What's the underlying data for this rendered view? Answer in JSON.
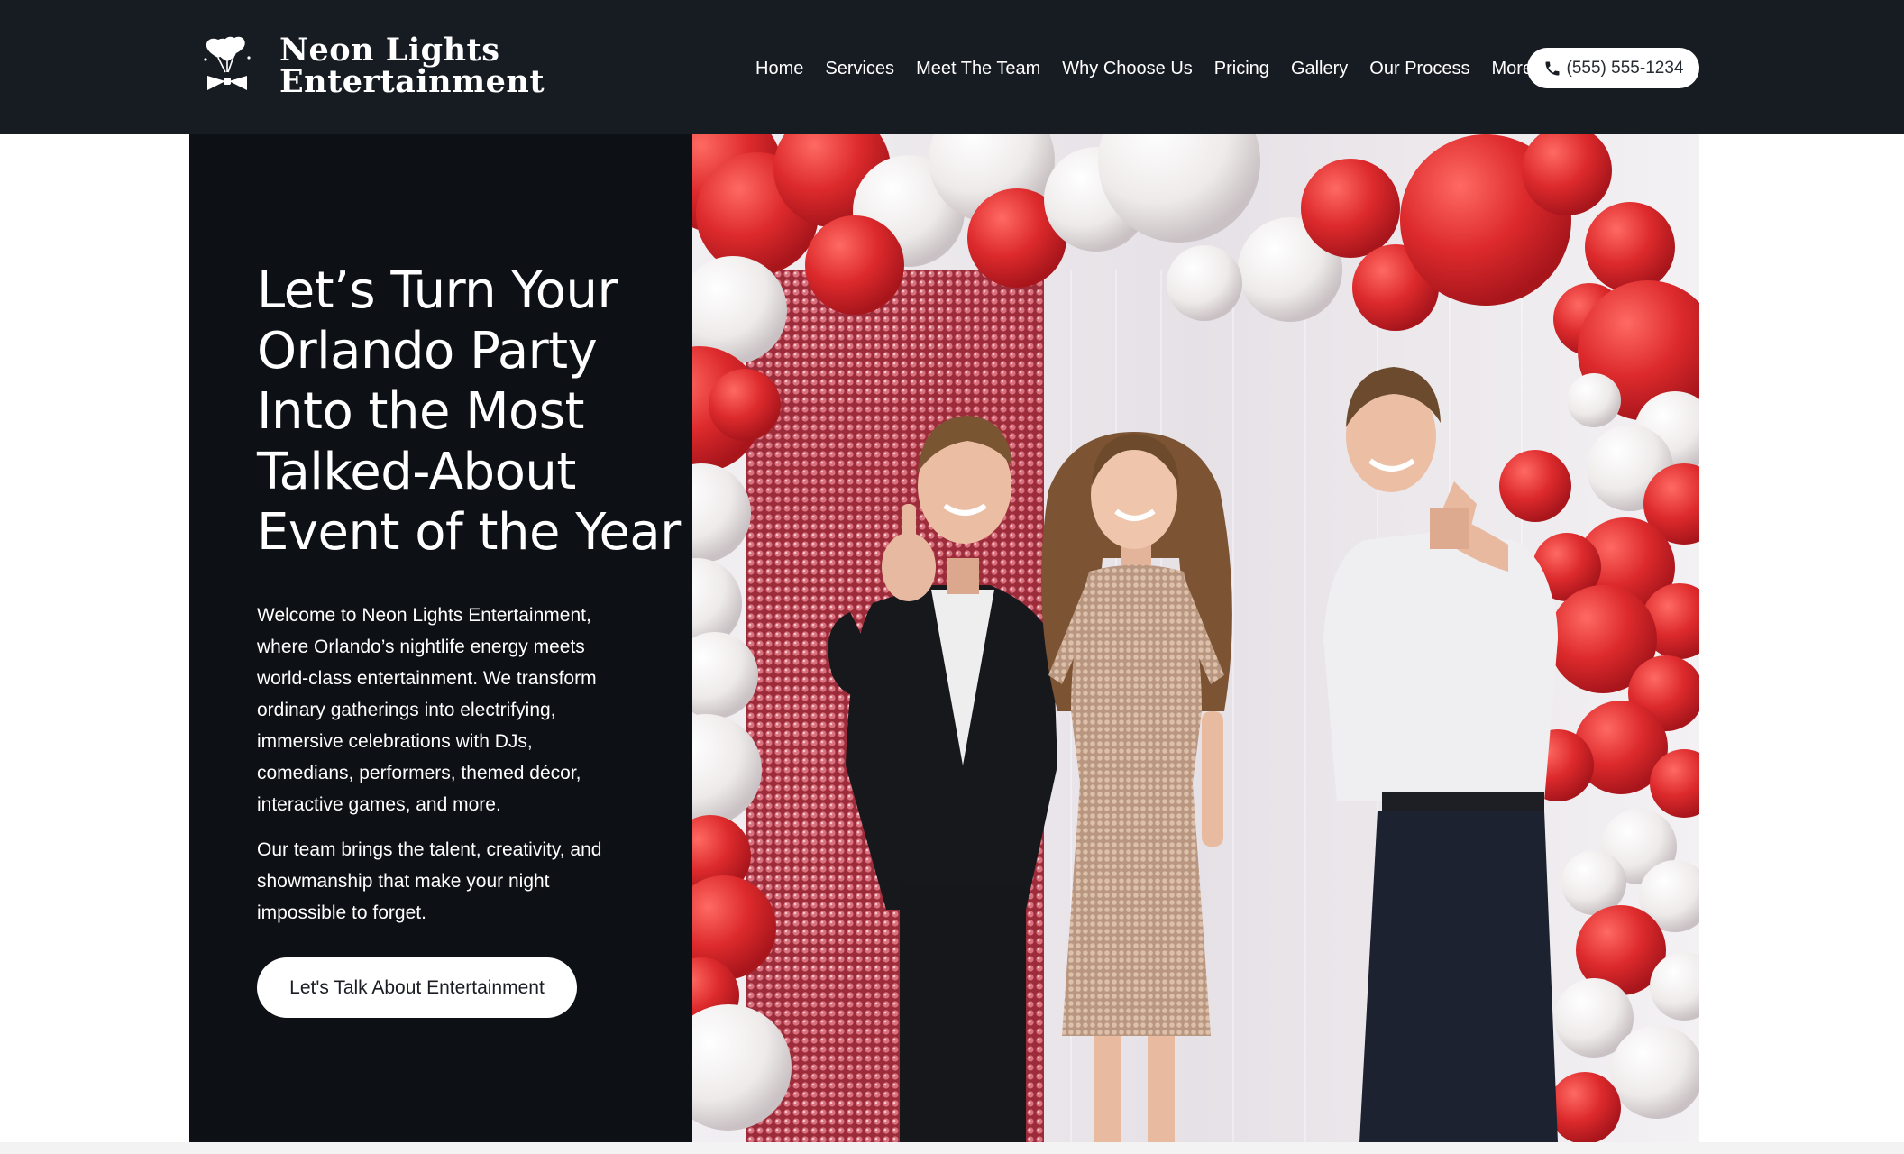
{
  "brand": {
    "name_line1": "Neon Lights",
    "name_line2": "Entertainment",
    "logo_icon": "balloons-bowtie-icon"
  },
  "nav": {
    "items": [
      {
        "label": "Home"
      },
      {
        "label": "Services"
      },
      {
        "label": "Meet The Team"
      },
      {
        "label": "Why Choose Us"
      },
      {
        "label": "Pricing"
      },
      {
        "label": "Gallery"
      },
      {
        "label": "Our Process"
      },
      {
        "label": "More"
      }
    ],
    "phone": "(555) 555-1234",
    "phone_icon": "phone-icon"
  },
  "hero": {
    "title_lines": [
      "Let’s Turn Your",
      "Orlando  Party",
      "Into the  Most",
      "Talked-About",
      "Event of the Year"
    ],
    "paragraph1": "Welcome to Neon Lights Entertainment, where Orlando’s nightlife energy meets world-class entertainment. We transform ordinary gatherings into electrifying, immersive celebrations with DJs, comedians, performers, themed décor, interactive games, and more.",
    "paragraph2": "Our team brings the talent, creativity, and showmanship that make your night impossible to forget.",
    "cta_label": "Let's Talk About  Entertainment",
    "image_subject": "party-photo"
  },
  "colors": {
    "header_bg": "#171b22",
    "hero_panel_bg": "#0d1015",
    "text_light": "#ffffff",
    "balloon_red": "#d9262b",
    "balloon_white": "#f1eeee",
    "sequin_pink": "#b8404f"
  }
}
